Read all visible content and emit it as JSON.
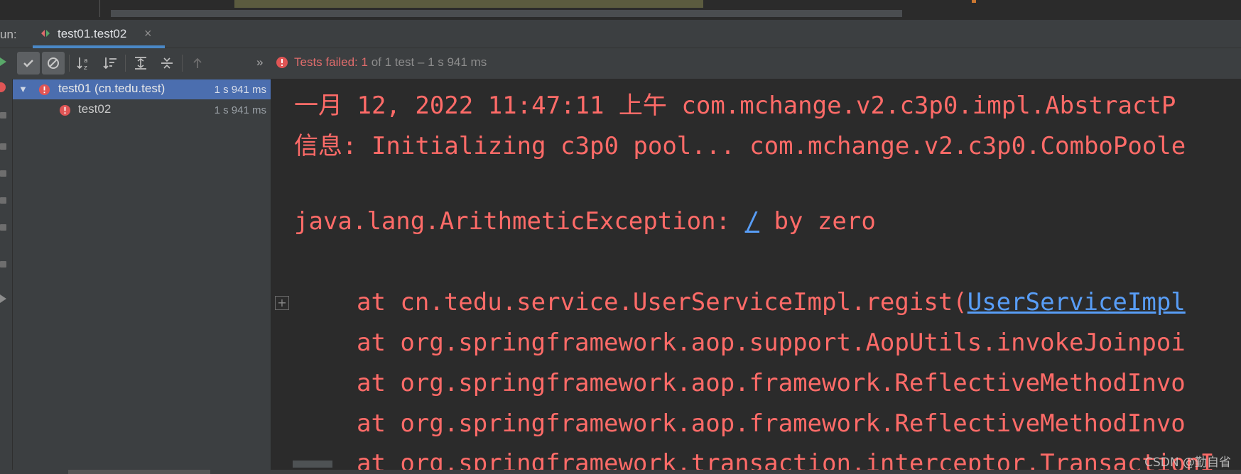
{
  "run_panel": {
    "label": "un:",
    "tab": {
      "title": "test01.test02",
      "close": "×"
    }
  },
  "toolbar": {
    "buttons": [
      "show-passed",
      "show-ignored",
      "sort-alphabetically",
      "sort-by-duration",
      "expand-all",
      "collapse-all",
      "previous-failed"
    ],
    "more": "»",
    "status": {
      "prefix": "Tests failed: ",
      "failed_count": "1",
      "suffix": " of 1 test – 1 s 941 ms"
    }
  },
  "tree": {
    "items": [
      {
        "name": "test01 (cn.tedu.test)",
        "duration": "1 s 941 ms",
        "selected": true
      },
      {
        "name": "test02",
        "duration": "1 s 941 ms",
        "selected": false
      }
    ]
  },
  "console": {
    "lines": [
      "一月 12, 2022 11:47:11 上午 com.mchange.v2.c3p0.impl.AbstractP",
      "信息: Initializing c3p0 pool... com.mchange.v2.c3p0.ComboPoole"
    ],
    "exception": {
      "prefix": "java.lang.ArithmeticException: ",
      "link": "/",
      "suffix": " by zero"
    },
    "stack": [
      {
        "text": "at cn.tedu.service.UserServiceImpl.regist(",
        "link": "UserServiceImpl"
      },
      {
        "text": "at org.springframework.aop.support.AopUtils.invokeJoinpoi",
        "link": ""
      },
      {
        "text": "at org.springframework.aop.framework.ReflectiveMethodInvo",
        "link": ""
      },
      {
        "text": "at org.springframework.aop.framework.ReflectiveMethodInvo",
        "link": ""
      },
      {
        "text": "at org.springframework.transaction.interceptor.TransactionI",
        "link": ""
      }
    ],
    "fold_icon": "+",
    "watermark": "CSDN @勤自省"
  },
  "colors": {
    "error_text": "#ff6b68",
    "link": "#589df6",
    "selection": "#4b6eaf",
    "tab_underline": "#4a88c7",
    "panel_bg": "#3c3f41",
    "editor_bg": "#2b2b2b"
  }
}
